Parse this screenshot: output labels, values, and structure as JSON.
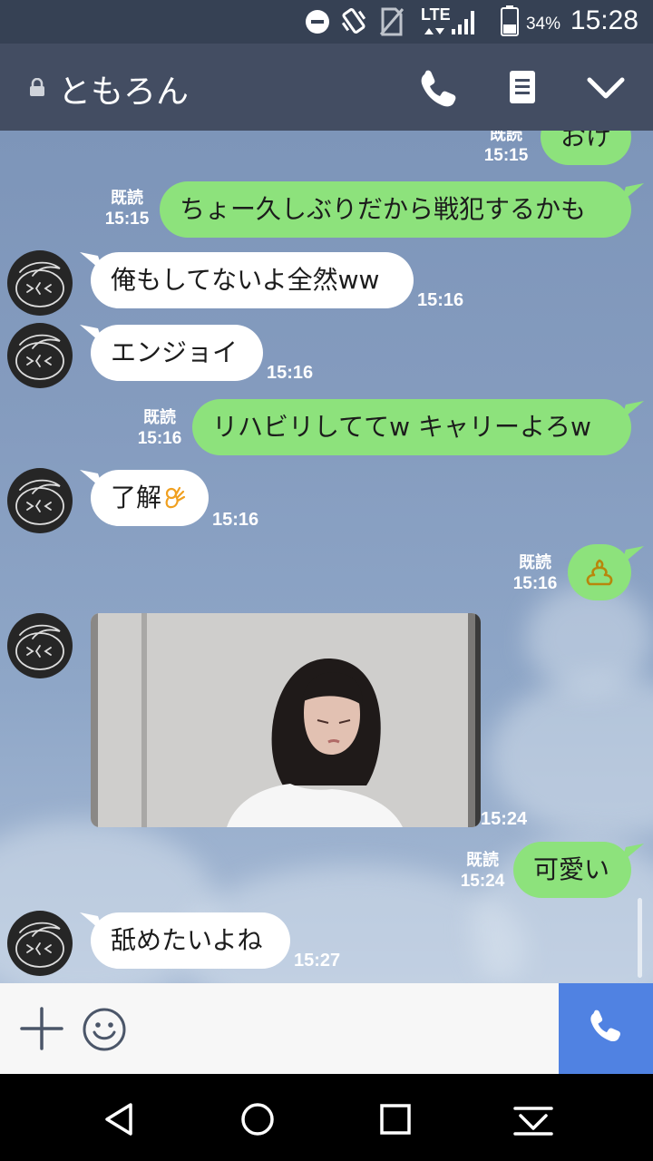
{
  "status_bar": {
    "network": "LTE",
    "battery": "34%",
    "time": "15:28"
  },
  "header": {
    "title": "ともろん"
  },
  "messages": [
    {
      "from": "me",
      "text": "おけ",
      "read": "既読",
      "time": "15:15"
    },
    {
      "from": "me",
      "text": "ちょー久しぶりだから戦犯するかも",
      "read": "既読",
      "time": "15:15"
    },
    {
      "from": "friend",
      "text": "俺もしてないよ全然ww",
      "time": "15:16"
    },
    {
      "from": "friend",
      "text": "エンジョイ",
      "time": "15:16"
    },
    {
      "from": "me",
      "text": "リハビリしててw キャリーよろw",
      "read": "既読",
      "time": "15:16"
    },
    {
      "from": "friend",
      "text": "了解",
      "emoji": "ok-hand",
      "time": "15:16"
    },
    {
      "from": "me",
      "sticker": "poop-icon",
      "read": "既読",
      "time": "15:16"
    },
    {
      "from": "friend",
      "image": "photo",
      "time": "15:24"
    },
    {
      "from": "me",
      "text": "可愛い",
      "read": "既読",
      "time": "15:24"
    },
    {
      "from": "friend",
      "text": "舐めたいよね",
      "time": "15:27"
    }
  ],
  "colors": {
    "status_bar": "#364154",
    "header": "#434d62",
    "bubble_out": "#8de27c",
    "bubble_in": "#ffffff",
    "call_button": "#5082e2"
  }
}
